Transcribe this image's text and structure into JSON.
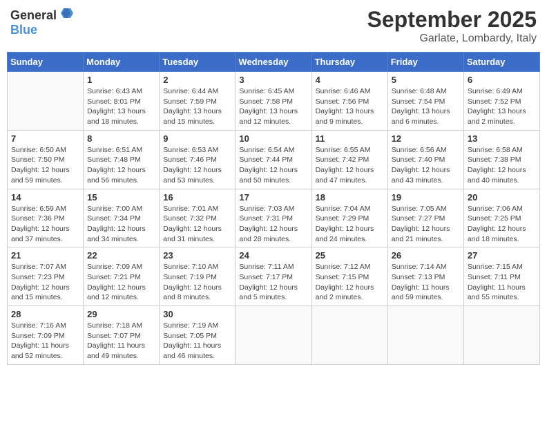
{
  "header": {
    "logo_general": "General",
    "logo_blue": "Blue",
    "month": "September 2025",
    "location": "Garlate, Lombardy, Italy"
  },
  "weekdays": [
    "Sunday",
    "Monday",
    "Tuesday",
    "Wednesday",
    "Thursday",
    "Friday",
    "Saturday"
  ],
  "weeks": [
    [
      {
        "day": "",
        "info": ""
      },
      {
        "day": "1",
        "info": "Sunrise: 6:43 AM\nSunset: 8:01 PM\nDaylight: 13 hours\nand 18 minutes."
      },
      {
        "day": "2",
        "info": "Sunrise: 6:44 AM\nSunset: 7:59 PM\nDaylight: 13 hours\nand 15 minutes."
      },
      {
        "day": "3",
        "info": "Sunrise: 6:45 AM\nSunset: 7:58 PM\nDaylight: 13 hours\nand 12 minutes."
      },
      {
        "day": "4",
        "info": "Sunrise: 6:46 AM\nSunset: 7:56 PM\nDaylight: 13 hours\nand 9 minutes."
      },
      {
        "day": "5",
        "info": "Sunrise: 6:48 AM\nSunset: 7:54 PM\nDaylight: 13 hours\nand 6 minutes."
      },
      {
        "day": "6",
        "info": "Sunrise: 6:49 AM\nSunset: 7:52 PM\nDaylight: 13 hours\nand 2 minutes."
      }
    ],
    [
      {
        "day": "7",
        "info": "Sunrise: 6:50 AM\nSunset: 7:50 PM\nDaylight: 12 hours\nand 59 minutes."
      },
      {
        "day": "8",
        "info": "Sunrise: 6:51 AM\nSunset: 7:48 PM\nDaylight: 12 hours\nand 56 minutes."
      },
      {
        "day": "9",
        "info": "Sunrise: 6:53 AM\nSunset: 7:46 PM\nDaylight: 12 hours\nand 53 minutes."
      },
      {
        "day": "10",
        "info": "Sunrise: 6:54 AM\nSunset: 7:44 PM\nDaylight: 12 hours\nand 50 minutes."
      },
      {
        "day": "11",
        "info": "Sunrise: 6:55 AM\nSunset: 7:42 PM\nDaylight: 12 hours\nand 47 minutes."
      },
      {
        "day": "12",
        "info": "Sunrise: 6:56 AM\nSunset: 7:40 PM\nDaylight: 12 hours\nand 43 minutes."
      },
      {
        "day": "13",
        "info": "Sunrise: 6:58 AM\nSunset: 7:38 PM\nDaylight: 12 hours\nand 40 minutes."
      }
    ],
    [
      {
        "day": "14",
        "info": "Sunrise: 6:59 AM\nSunset: 7:36 PM\nDaylight: 12 hours\nand 37 minutes."
      },
      {
        "day": "15",
        "info": "Sunrise: 7:00 AM\nSunset: 7:34 PM\nDaylight: 12 hours\nand 34 minutes."
      },
      {
        "day": "16",
        "info": "Sunrise: 7:01 AM\nSunset: 7:32 PM\nDaylight: 12 hours\nand 31 minutes."
      },
      {
        "day": "17",
        "info": "Sunrise: 7:03 AM\nSunset: 7:31 PM\nDaylight: 12 hours\nand 28 minutes."
      },
      {
        "day": "18",
        "info": "Sunrise: 7:04 AM\nSunset: 7:29 PM\nDaylight: 12 hours\nand 24 minutes."
      },
      {
        "day": "19",
        "info": "Sunrise: 7:05 AM\nSunset: 7:27 PM\nDaylight: 12 hours\nand 21 minutes."
      },
      {
        "day": "20",
        "info": "Sunrise: 7:06 AM\nSunset: 7:25 PM\nDaylight: 12 hours\nand 18 minutes."
      }
    ],
    [
      {
        "day": "21",
        "info": "Sunrise: 7:07 AM\nSunset: 7:23 PM\nDaylight: 12 hours\nand 15 minutes."
      },
      {
        "day": "22",
        "info": "Sunrise: 7:09 AM\nSunset: 7:21 PM\nDaylight: 12 hours\nand 12 minutes."
      },
      {
        "day": "23",
        "info": "Sunrise: 7:10 AM\nSunset: 7:19 PM\nDaylight: 12 hours\nand 8 minutes."
      },
      {
        "day": "24",
        "info": "Sunrise: 7:11 AM\nSunset: 7:17 PM\nDaylight: 12 hours\nand 5 minutes."
      },
      {
        "day": "25",
        "info": "Sunrise: 7:12 AM\nSunset: 7:15 PM\nDaylight: 12 hours\nand 2 minutes."
      },
      {
        "day": "26",
        "info": "Sunrise: 7:14 AM\nSunset: 7:13 PM\nDaylight: 11 hours\nand 59 minutes."
      },
      {
        "day": "27",
        "info": "Sunrise: 7:15 AM\nSunset: 7:11 PM\nDaylight: 11 hours\nand 55 minutes."
      }
    ],
    [
      {
        "day": "28",
        "info": "Sunrise: 7:16 AM\nSunset: 7:09 PM\nDaylight: 11 hours\nand 52 minutes."
      },
      {
        "day": "29",
        "info": "Sunrise: 7:18 AM\nSunset: 7:07 PM\nDaylight: 11 hours\nand 49 minutes."
      },
      {
        "day": "30",
        "info": "Sunrise: 7:19 AM\nSunset: 7:05 PM\nDaylight: 11 hours\nand 46 minutes."
      },
      {
        "day": "",
        "info": ""
      },
      {
        "day": "",
        "info": ""
      },
      {
        "day": "",
        "info": ""
      },
      {
        "day": "",
        "info": ""
      }
    ]
  ]
}
